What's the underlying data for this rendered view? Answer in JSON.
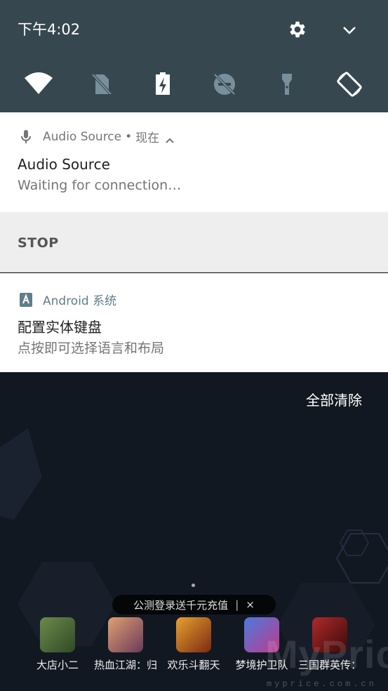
{
  "status": {
    "time": "下午4:02"
  },
  "quick_settings": {
    "tiles": [
      {
        "icon": "wifi-icon",
        "state": "on"
      },
      {
        "icon": "sim-off-icon",
        "state": "off"
      },
      {
        "icon": "battery-charging-icon",
        "state": "on"
      },
      {
        "icon": "do-not-disturb-icon",
        "state": "off"
      },
      {
        "icon": "flashlight-icon",
        "state": "off"
      },
      {
        "icon": "auto-rotate-icon",
        "state": "on"
      }
    ]
  },
  "notifications": [
    {
      "app": "Audio Source",
      "time": "现在",
      "title": "Audio Source",
      "text": "Waiting for connection…",
      "action": "STOP"
    },
    {
      "app": "Android 系统",
      "title": "配置实体键盘",
      "text": "点按即可选择语言和布局"
    }
  ],
  "clear_all_label": "全部清除",
  "promo": {
    "text": "公测登录送千元充值",
    "close": "×"
  },
  "apps": [
    {
      "label": "大店小二",
      "color": "#4a6b3a"
    },
    {
      "label": "热血江湖：归",
      "color": "#c46a4a"
    },
    {
      "label": "欢乐斗翻天",
      "color": "#b86a1a"
    },
    {
      "label": "梦境护卫队",
      "color": "#3a5ab8"
    },
    {
      "label": "三国群英传：",
      "color": "#8a1a1a"
    }
  ],
  "watermark": {
    "text": "MyPrice",
    "sub": "myprice.com.cn"
  },
  "colors": {
    "qs_bg": "#37474f",
    "accent": "#607d8b",
    "home_bg": "#121822"
  }
}
